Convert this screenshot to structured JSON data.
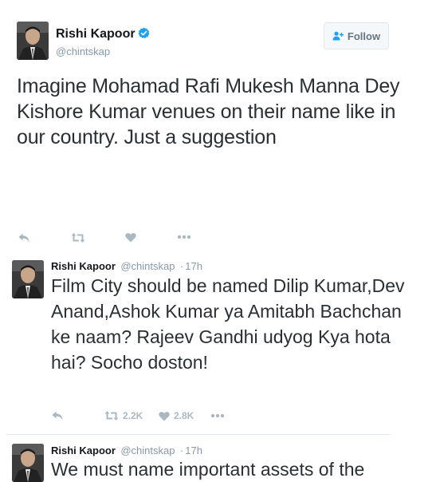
{
  "main_tweet": {
    "name": "Rishi Kapoor",
    "handle": "@chintskap",
    "follow_label": "Follow",
    "text": "Imagine Mohamad Rafi Mukesh Manna Dey Kishore Kumar venues on their name like in our country. Just a suggestion",
    "verified": true,
    "icons": [
      "reply-icon",
      "retweet-icon",
      "like-icon",
      "more-icon"
    ]
  },
  "replies": [
    {
      "name": "Rishi Kapoor",
      "handle": "@chintskap",
      "separator": "·",
      "time": "17h",
      "text": "Film City should be named Dilip Kumar,Dev Anand,Ashok Kumar ya Amitabh Bachchan ke naam? Rajeev Gandhi udyog Kya hota hai? Socho doston!",
      "retweets": "2.2K",
      "likes": "2.8K"
    },
    {
      "name": "Rishi Kapoor",
      "handle": "@chintskap",
      "separator": "·",
      "time": "17h",
      "text": "We must name important assets of the"
    }
  ],
  "colors": {
    "verified": "#1da1f2",
    "muted": "#8899a6",
    "action_icon": "#aab8c2",
    "divider": "#e1e8ed"
  }
}
